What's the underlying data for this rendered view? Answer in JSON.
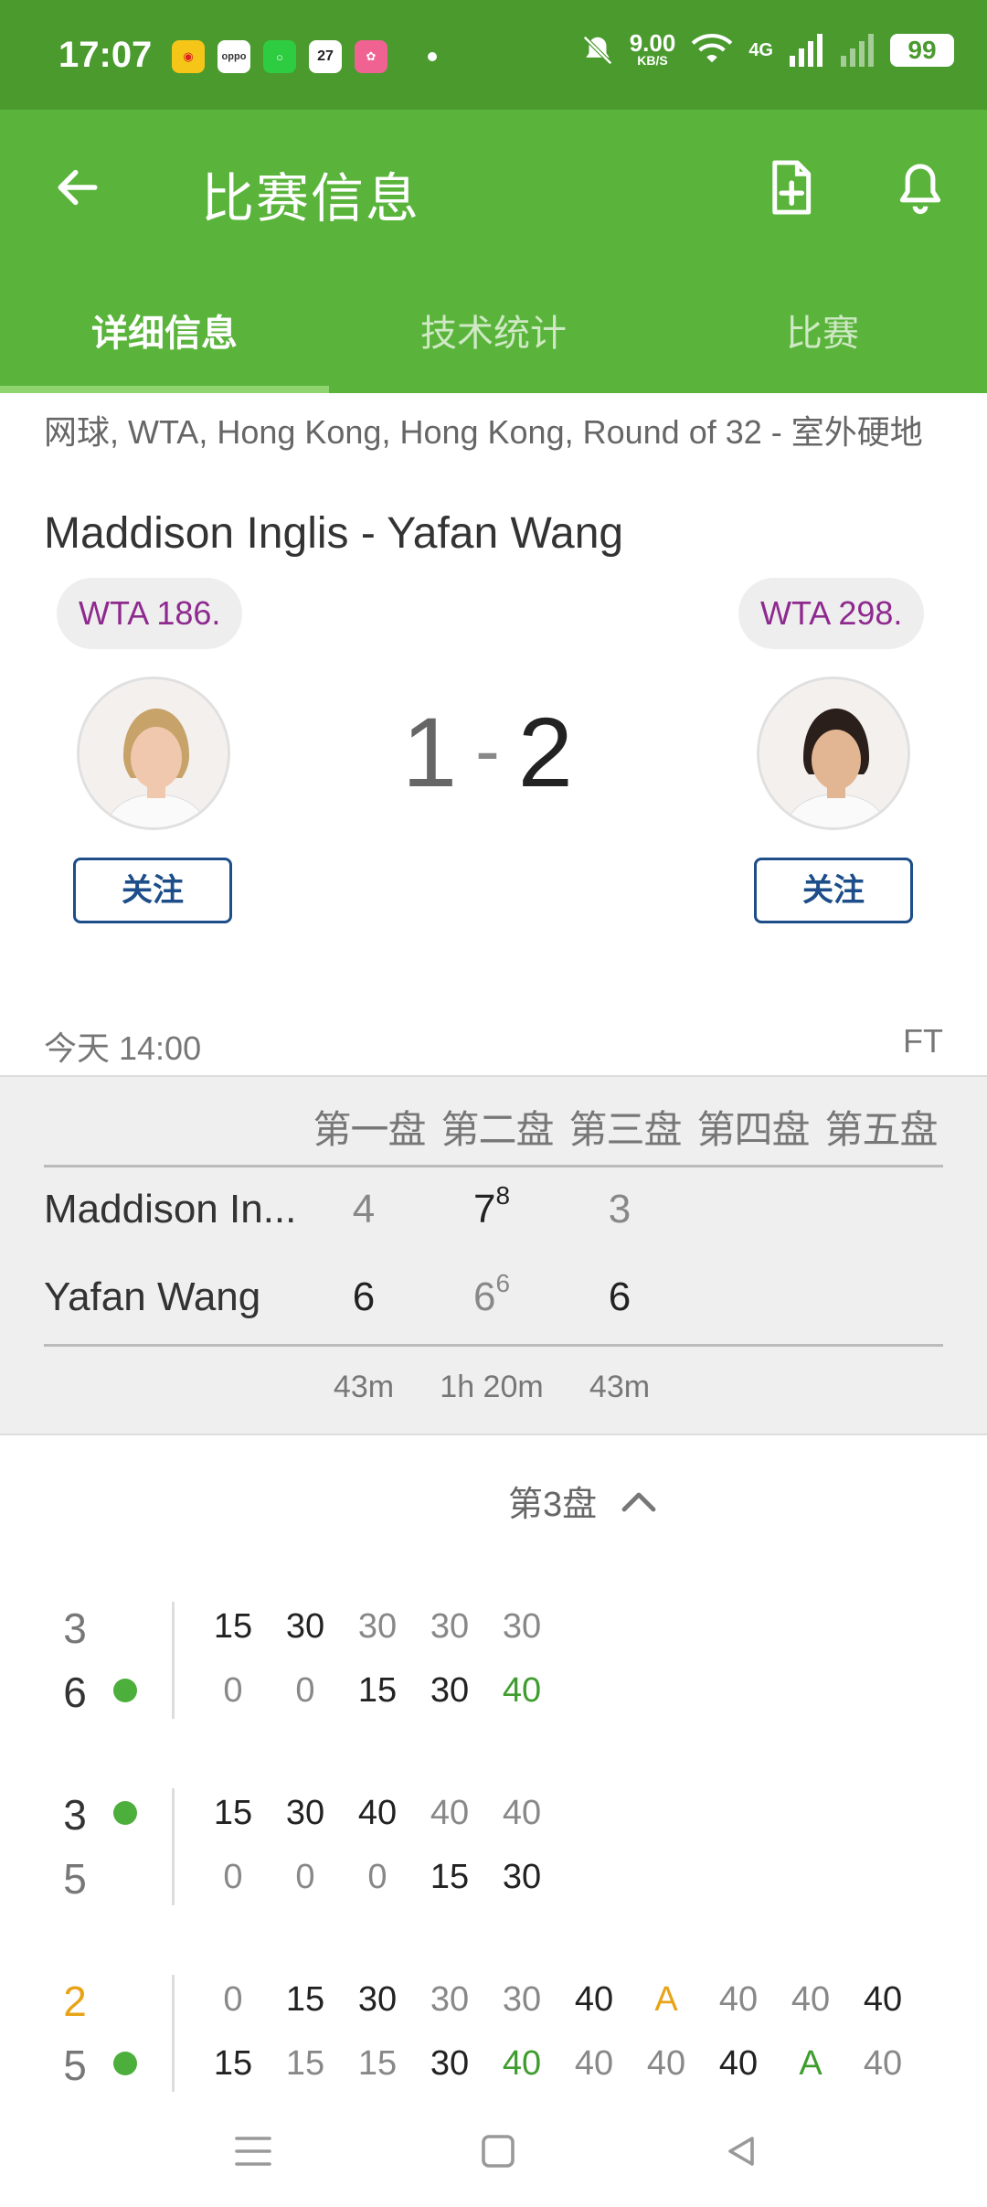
{
  "status_bar": {
    "time": "17:07",
    "net_speed": "9.00",
    "net_unit": "KB/S",
    "network": "4G",
    "battery": "99",
    "app_icons": [
      "weibo-icon",
      "oppo-icon",
      "green-app-icon",
      "calendar-icon",
      "pink-app-icon"
    ],
    "calendar_day": "27",
    "oppo_label": "oppo"
  },
  "app_bar": {
    "title": "比赛信息",
    "tabs": [
      {
        "label": "详细信息",
        "active": true
      },
      {
        "label": "技术统计",
        "active": false
      },
      {
        "label": "比赛",
        "active": false
      }
    ]
  },
  "match": {
    "meta": "网球, WTA, Hong Kong, Hong Kong, Round of 32 - 室外硬地",
    "title": "Maddison Inglis - Yafan Wang",
    "home": {
      "rank": "WTA 186.",
      "follow": "关注"
    },
    "away": {
      "rank": "WTA 298.",
      "follow": "关注"
    },
    "score_home": "1",
    "score_sep": "-",
    "score_away": "2",
    "date": "今天 14:00",
    "status": "FT"
  },
  "sets_table": {
    "headers": [
      "第一盘",
      "第二盘",
      "第三盘",
      "第四盘",
      "第五盘"
    ],
    "rows": [
      {
        "name": "Maddison In...",
        "s1": "4",
        "s2": "7",
        "s2_tb": "8",
        "s3": "3"
      },
      {
        "name": "Yafan Wang",
        "s1": "6",
        "s2": "6",
        "s2_tb": "6",
        "s3": "6"
      }
    ],
    "durations": [
      "43m",
      "1h 20m",
      "43m"
    ]
  },
  "set_selector": {
    "label": "第3盘"
  },
  "games": [
    {
      "top_score": "3",
      "bottom_score": "6",
      "top_points": [
        "15",
        "30",
        "30",
        "30",
        "30"
      ],
      "bottom_points": [
        "0",
        "0",
        "15",
        "30",
        "40"
      ]
    },
    {
      "top_score": "3",
      "bottom_score": "5",
      "top_points": [
        "15",
        "30",
        "40",
        "40",
        "40"
      ],
      "bottom_points": [
        "0",
        "0",
        "0",
        "15",
        "30"
      ]
    },
    {
      "top_score": "2",
      "bottom_score": "5",
      "top_points": [
        "0",
        "15",
        "30",
        "30",
        "30",
        "40",
        "A",
        "40",
        "40",
        "40"
      ],
      "bottom_points": [
        "15",
        "15",
        "15",
        "30",
        "40",
        "40",
        "40",
        "40",
        "A",
        "40"
      ]
    }
  ],
  "colors": {
    "status_bar": "#4a9a2e",
    "app_bar": "#5ab43b",
    "rank_text": "#8e2a8e",
    "follow_border": "#1d4e89",
    "serve_dot": "#4cae3b",
    "advantage": "#e8a317"
  }
}
